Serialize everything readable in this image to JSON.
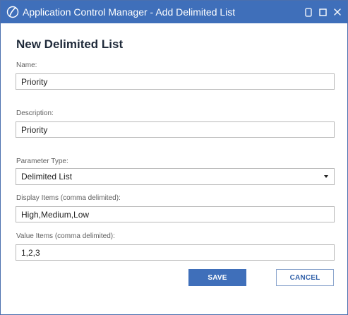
{
  "window": {
    "title": "Application Control Manager - Add Delimited List",
    "icons": {
      "logo": "app-logo-icon",
      "phone": "phone-icon",
      "maximize": "maximize-icon",
      "close": "close-icon"
    },
    "accent_color": "#3f6fba"
  },
  "form": {
    "heading": "New Delimited List",
    "name": {
      "label": "Name:",
      "value": "Priority"
    },
    "description": {
      "label": "Description:",
      "value": "Priority"
    },
    "parameter_type": {
      "label": "Parameter Type:",
      "value": "Delimited List"
    },
    "display_items": {
      "label": "Display Items (comma delimited):",
      "value": "High,Medium,Low"
    },
    "value_items": {
      "label": "Value Items (comma delimited):",
      "value": "1,2,3"
    }
  },
  "buttons": {
    "save": "SAVE",
    "cancel": "CANCEL"
  }
}
